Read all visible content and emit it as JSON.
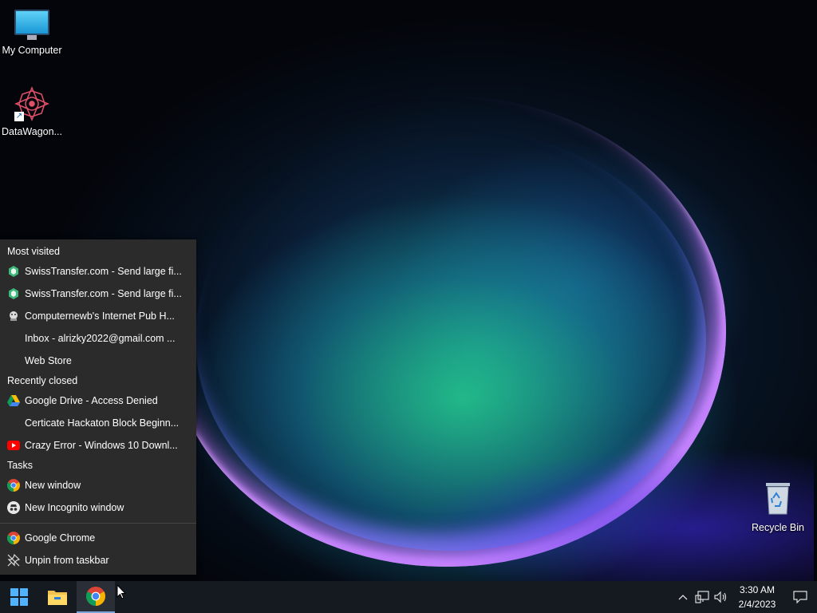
{
  "desktop": {
    "icons": [
      {
        "label": "My Computer"
      },
      {
        "label": "DataWagon..."
      },
      {
        "label": "Recycle Bin"
      }
    ]
  },
  "jumplist": {
    "most_visited": {
      "header": "Most visited",
      "items": [
        {
          "label": "SwissTransfer.com - Send large fi...",
          "icon": "swisstransfer-icon"
        },
        {
          "label": "SwissTransfer.com - Send large fi...",
          "icon": "swisstransfer-icon"
        },
        {
          "label": "Computernewb's Internet Pub H...",
          "icon": "computernewb-icon"
        },
        {
          "label": "Inbox - alrizky2022@gmail.com ...",
          "icon": "none"
        },
        {
          "label": "Web Store",
          "icon": "none"
        }
      ]
    },
    "recently_closed": {
      "header": "Recently closed",
      "items": [
        {
          "label": "Google Drive - Access Denied",
          "icon": "google-drive-icon"
        },
        {
          "label": "Certicate Hackaton Block Beginn...",
          "icon": "none"
        },
        {
          "label": "Crazy Error - Windows 10 Downl...",
          "icon": "youtube-icon"
        }
      ]
    },
    "tasks": {
      "header": "Tasks",
      "items": [
        {
          "label": "New window",
          "icon": "chrome-icon"
        },
        {
          "label": "New Incognito window",
          "icon": "incognito-icon"
        }
      ]
    },
    "app": {
      "label": "Google Chrome",
      "icon": "chrome-icon"
    },
    "unpin": {
      "label": "Unpin from taskbar",
      "icon": "unpin-icon"
    }
  },
  "taskbar": {
    "clock": {
      "time": "3:30 AM",
      "date": "2/4/2023"
    }
  },
  "colors": {
    "jumplist_bg": "#2b2b2b",
    "taskbar_bg": "#151a21",
    "accent": "#7aa7d8"
  }
}
